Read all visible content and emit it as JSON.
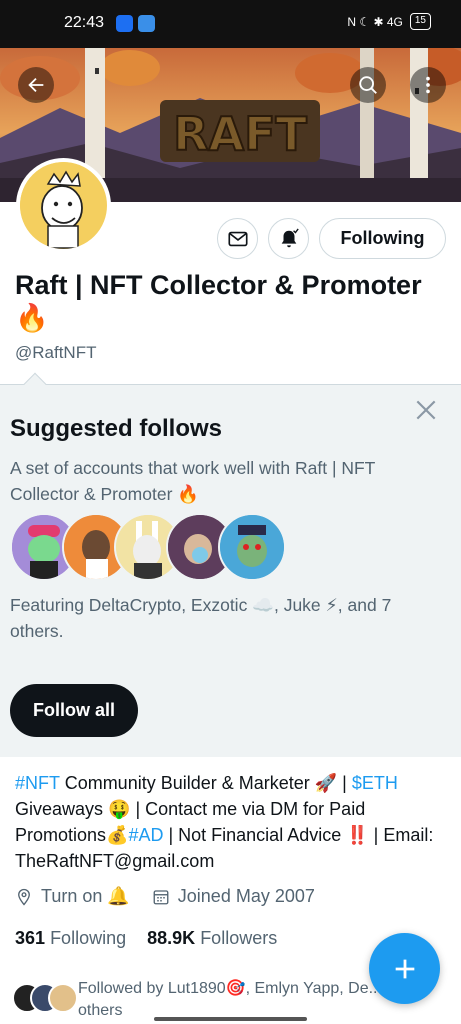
{
  "status_bar": {
    "time": "22:43",
    "right_text": "N ☾ ✱ 4G",
    "battery": "15"
  },
  "banner": {
    "text": "RAFT"
  },
  "icons": {
    "back": "arrow-left-icon",
    "search": "search-icon",
    "more": "more-vertical-icon",
    "mail": "mail-icon",
    "bell": "bell-notification-icon",
    "close": "close-icon",
    "location": "location-pin-icon",
    "calendar": "calendar-icon",
    "compose": "plus-icon"
  },
  "profile": {
    "following_button": "Following",
    "display_name": "Raft | NFT Collector & Promoter 🔥",
    "handle": "@RaftNFT"
  },
  "suggested": {
    "title": "Suggested follows",
    "description": "A set of accounts that work well with Raft | NFT Collector & Promoter 🔥",
    "featuring": "Featuring DeltaCrypto, Exzotic ☁️, Juke ⚡, and 7 others.",
    "follow_all": "Follow all"
  },
  "bio": {
    "tag_nft": "#NFT",
    "text1": " Community Builder & Marketer 🚀 | ",
    "tag_eth": "$ETH",
    "text2": " Giveaways 🤑 | Contact me via DM for Paid Promotions💰",
    "tag_ad": "#AD",
    "text3": " | Not Financial Advice ‼️ | Email: TheRaftNFT@gmail.com"
  },
  "meta": {
    "location": "Turn on 🔔",
    "joined": "Joined May 2007"
  },
  "counts": {
    "following_num": "361",
    "following_label": "Following",
    "followers_num": "88.9K",
    "followers_label": "Followers"
  },
  "followed_by": {
    "text": "Followed by Lut1890🎯, Emlyn Yapp, De... 8 others"
  },
  "colors": {
    "accent": "#1d9bf0",
    "dark": "#0f1419",
    "muted": "#536471",
    "panel": "#eff3f4"
  }
}
